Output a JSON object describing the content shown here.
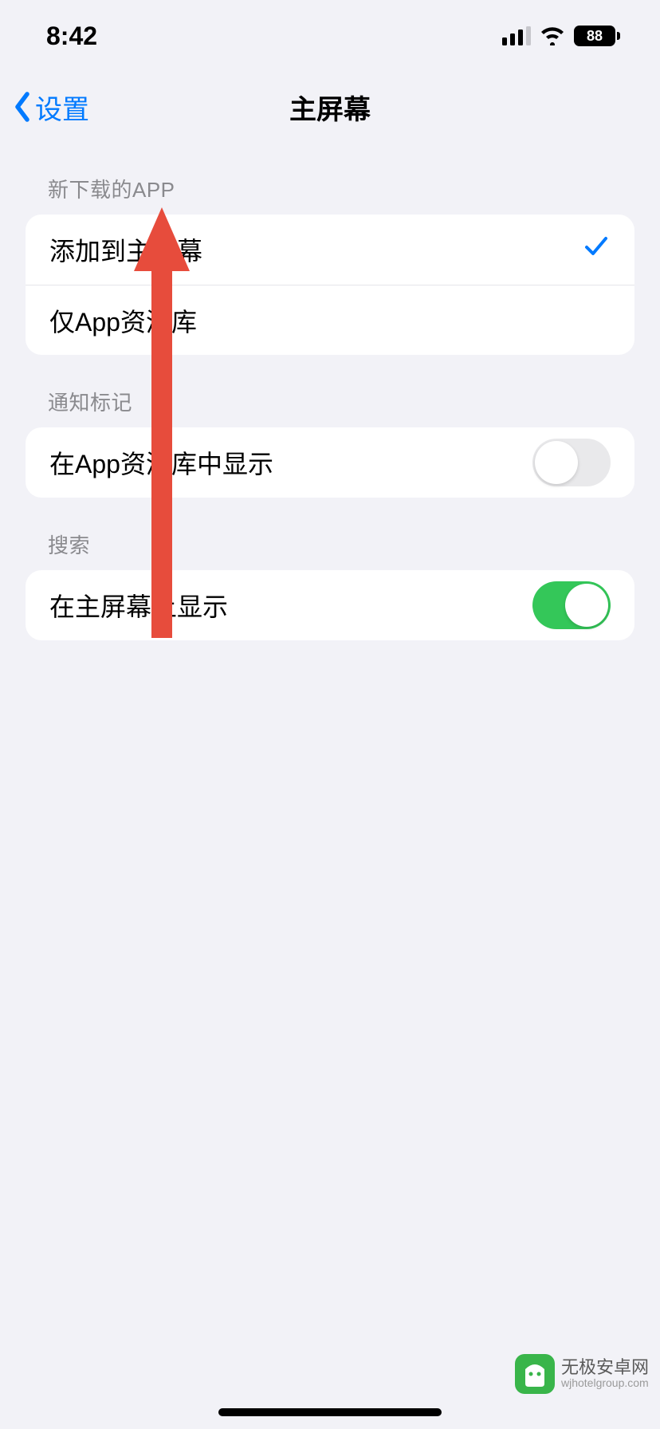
{
  "status": {
    "time": "8:42",
    "battery": "88"
  },
  "nav": {
    "back": "设置",
    "title": "主屏幕"
  },
  "sections": {
    "newly_downloaded": {
      "header": "新下载的APP",
      "option_add": "添加到主屏幕",
      "option_library": "仅App资源库"
    },
    "badges": {
      "header": "通知标记",
      "show_in_library": "在App资源库中显示"
    },
    "search": {
      "header": "搜索",
      "show_on_home": "在主屏幕上显示"
    }
  },
  "watermark": {
    "line1": "无极安卓网",
    "line2": "wjhotelgroup.com"
  }
}
